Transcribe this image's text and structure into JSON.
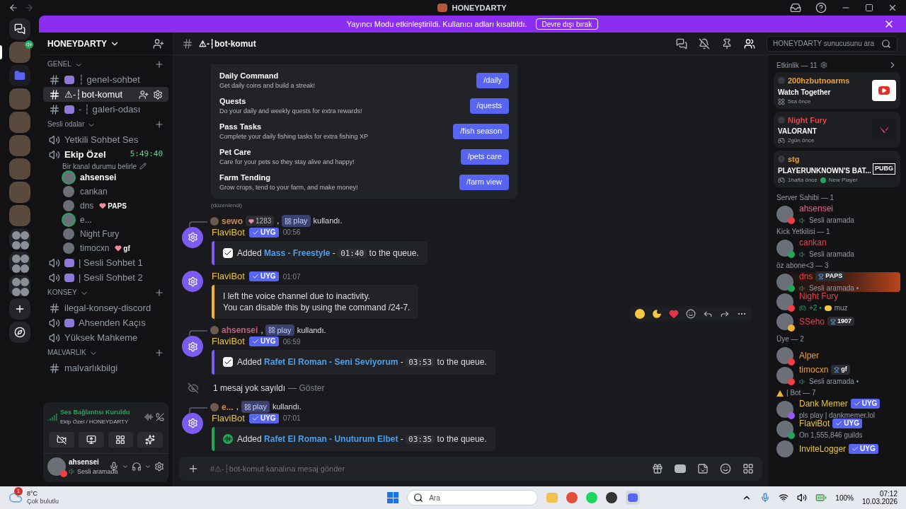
{
  "titlebar": {
    "title": "HONEYDARTY"
  },
  "banner": {
    "text": "Yayıncı Modu etkinleştirildi. Kullanıcı adları kısaltıldı.",
    "button": "Devre dışı bırak"
  },
  "servers": [
    {
      "kind": "home",
      "selected": false,
      "in_voice": false
    },
    {
      "kind": "server",
      "selected": true,
      "in_voice": true
    },
    {
      "kind": "folder",
      "selected": false,
      "in_voice": false
    },
    {
      "kind": "server",
      "selected": false,
      "in_voice": false
    },
    {
      "kind": "server",
      "selected": false,
      "in_voice": false
    },
    {
      "kind": "server",
      "selected": false,
      "in_voice": false
    },
    {
      "kind": "server",
      "selected": false,
      "in_voice": false
    },
    {
      "kind": "server",
      "selected": false,
      "in_voice": false
    },
    {
      "kind": "server",
      "selected": false,
      "in_voice": false
    },
    {
      "kind": "group",
      "selected": false,
      "in_voice": false
    },
    {
      "kind": "group",
      "selected": false,
      "in_voice": false
    },
    {
      "kind": "group",
      "selected": false,
      "in_voice": false
    },
    {
      "kind": "add",
      "selected": false,
      "in_voice": false
    },
    {
      "kind": "discover",
      "selected": false,
      "in_voice": false
    }
  ],
  "sidebar": {
    "server_name": "HONEYDARTY",
    "categories": [
      {
        "name": "GENEL",
        "channels": [
          {
            "kind": "text",
            "name": "┆ genel-sohbet",
            "emoji": true,
            "selected": false
          },
          {
            "kind": "text",
            "name": "⚠-┆bot-komut",
            "emoji": false,
            "selected": true
          },
          {
            "kind": "text",
            "name": "- ┆ galeri-odası",
            "emoji": true,
            "selected": false
          }
        ]
      },
      {
        "name": "Sesli odalar",
        "channels": [
          {
            "kind": "voice",
            "name": "Yetkili Sohbet Ses",
            "emoji": false,
            "selected": false
          },
          {
            "kind": "voice",
            "name": "Ekip Özel",
            "emoji": false,
            "selected": false,
            "timer": "5:49:40",
            "status": "Bir kanal durumu belirle",
            "users": [
              {
                "name": "ahsensei",
                "speaking": true,
                "self": true
              },
              {
                "name": "cankan",
                "speaking": false,
                "self": false
              },
              {
                "name": "dns",
                "speaking": false,
                "self": false,
                "badge": "PAPS"
              },
              {
                "name": "e...",
                "speaking": true,
                "self": false
              },
              {
                "name": "Night Fury",
                "speaking": false,
                "self": false
              },
              {
                "name": "timocxn",
                "speaking": false,
                "self": false,
                "badge": "gf"
              }
            ]
          },
          {
            "kind": "voice",
            "name": "| Sesli Sohbet 1",
            "emoji": true,
            "selected": false
          },
          {
            "kind": "voice",
            "name": "| Sesli Sohbet 2",
            "emoji": true,
            "selected": false
          }
        ]
      },
      {
        "name": "KONSEY",
        "channels": [
          {
            "kind": "text",
            "name": "ilegal-konsey-discord",
            "emoji": false,
            "selected": false
          },
          {
            "kind": "voice",
            "name": "Ahsenden Kaçıs",
            "emoji": true,
            "selected": false
          },
          {
            "kind": "voice",
            "name": "Yüksek Mahkeme",
            "emoji": false,
            "selected": false
          }
        ]
      },
      {
        "name": "MALVARLIK",
        "channels": [
          {
            "kind": "text",
            "name": "malvarlıkbilgi",
            "emoji": false,
            "selected": false
          }
        ]
      }
    ]
  },
  "voice_panel": {
    "status": "Ses Bağlantısı Kuruldu",
    "location": "Ekip Özel / HONEYDARTY"
  },
  "user_panel": {
    "name": "ahsensei",
    "status": "Sesli aramada",
    "presence": {
      "color": "#f23f43"
    }
  },
  "header": {
    "channel": "⚠-┆bot-komut",
    "search_placeholder": "HONEYDARTY sunucusunu ara"
  },
  "embed": {
    "rows": [
      {
        "title": "Daily Command",
        "desc": "Get daily coins and build a streak!",
        "button": "/daily"
      },
      {
        "title": "Quests",
        "desc": "Do your daily and weekly quests for extra rewards!",
        "button": "/quests"
      },
      {
        "title": "Pass Tasks",
        "desc": "Complete your daily fishing tasks for extra fishing XP",
        "button": "/fish season"
      },
      {
        "title": "Pet Care",
        "desc": "Care for your pets so they stay alive and happy!",
        "button": "/pets care"
      },
      {
        "title": "Farm Tending",
        "desc": "Grow crops, tend to your farm, and make money!",
        "button": "/farm view"
      }
    ],
    "edited": "(düzenlendi)"
  },
  "messages": [
    {
      "kind": "message",
      "reply": {
        "user": "sewo",
        "color": "#c98a4b",
        "badge": "1283",
        "sep": ",",
        "command": "play",
        "verb": "kullandı."
      },
      "author": "FlaviBot",
      "tag": "UYG",
      "time": "00:56",
      "embed": {
        "kind": "queued",
        "color": "#7c5cf0",
        "prefix": "Added",
        "song": "Mass -  Freestyle",
        "sep": "-",
        "duration": "01:40",
        "suffix": "to the queue."
      }
    },
    {
      "kind": "message",
      "author": "FlaviBot",
      "tag": "UYG",
      "time": "01:07",
      "embed": {
        "kind": "notice",
        "color": "#f0b232",
        "lines": [
          "I left the voice channel due to inactivity.",
          "You can disable this by using the command /24-7."
        ]
      }
    },
    {
      "kind": "message",
      "reply": {
        "user": "ahsensei",
        "color": "#c0607a",
        "sep": ",",
        "command": "play",
        "verb": "kullandı."
      },
      "author": "FlaviBot",
      "tag": "UYG",
      "time": "06:59",
      "embed": {
        "kind": "queued",
        "color": "#7c5cf0",
        "prefix": "Added",
        "song": "Rafet El Roman - Seni Seviyorum",
        "sep": "-",
        "duration": "03:53",
        "suffix": "to the queue."
      }
    },
    {
      "kind": "ignored",
      "text": "1 mesaj yok sayıldı",
      "action": "— Göster"
    },
    {
      "kind": "message",
      "reply": {
        "user": "e...",
        "color": "#c98a4b",
        "sep": ",",
        "command": "play",
        "verb": "kullandı."
      },
      "author": "FlaviBot",
      "tag": "UYG",
      "time": "07:01",
      "embed": {
        "kind": "streamed",
        "color": "#23a55a",
        "prefix": "Added",
        "song": "Rafet El Roman - Unuturum Elbet",
        "sep": "-",
        "duration": "03:35",
        "suffix": "to the queue."
      }
    }
  ],
  "composer": {
    "placeholder": "#⚠-┆bot-komut kanalına mesaj gönder"
  },
  "members": {
    "activity_title": "Etkinlik — 11",
    "activities": [
      {
        "kind": "app",
        "user": "200hzbutnoarms",
        "color": "#e8a23a",
        "title": "Watch Together",
        "meta": "5sa önce"
      },
      {
        "kind": "game",
        "user": "Night Fury",
        "color": "#e0474c",
        "title": "VALORANT",
        "meta": "2gün önce"
      },
      {
        "kind": "game",
        "user": "stg",
        "color": "#e8a23a",
        "title": "PLAYERUNKNOWN'S BAT...",
        "meta": "1hafta önce",
        "extra": "New Player",
        "thumb_text": "PUBG"
      }
    ],
    "groups": [
      {
        "title": "Server Sahibi — 1",
        "warn": false,
        "members": [
          {
            "kind": "voice",
            "name": "ahsensei",
            "color": "#e06c8c",
            "presence": {
              "color": "#f23f43"
            },
            "highlight": false,
            "status": "Sesli aramada"
          }
        ]
      },
      {
        "title": "Kick Yetkilisi — 1",
        "warn": false,
        "members": [
          {
            "kind": "voice",
            "name": "cankan",
            "color": "#e0474c",
            "presence": {
              "color": "#23a55a"
            },
            "highlight": false,
            "status": "Sesli aramada"
          }
        ]
      },
      {
        "title": "öz abone<3 — 3",
        "warn": false,
        "members": [
          {
            "kind": "voice",
            "name": "dns",
            "color": "#e0474c",
            "presence": {
              "color": "#23a55a"
            },
            "highlight": true,
            "badge": "PAPS",
            "status": "Sesli aramada •"
          },
          {
            "kind": "game",
            "name": "Night Fury",
            "color": "#e0474c",
            "presence": {
              "color": "#f23f43"
            },
            "highlight": false,
            "status_lead": "+2 •",
            "status": "muz"
          },
          {
            "kind": "plain",
            "name": "SSeho",
            "color": "#e0474c",
            "presence": {
              "color": "#f0b232"
            },
            "highlight": false,
            "badge": "1907"
          }
        ]
      },
      {
        "title": "Üye — 2",
        "warn": false,
        "members": [
          {
            "kind": "plain",
            "name": "Alper",
            "color": "#e8a23a",
            "presence": {
              "color": "#f23f43"
            },
            "highlight": false
          },
          {
            "kind": "voice",
            "name": "timocxn",
            "color": "#e8a23a",
            "presence": {
              "color": "#f23f43"
            },
            "highlight": false,
            "badge": "gf",
            "status": "Sesli aramada •"
          }
        ]
      },
      {
        "title": "| Bot — 7",
        "warn": true,
        "members": [
          {
            "kind": "text",
            "name": "Dank Memer",
            "color": "#e8c63a",
            "presence": {
              "color": "#9b59f5"
            },
            "highlight": false,
            "tag": "UYG",
            "status": "pls play | dankmemer.lol"
          },
          {
            "kind": "text",
            "name": "FlaviBot",
            "color": "#e8c63a",
            "presence": {
              "color": "#23a55a"
            },
            "highlight": false,
            "tag": "UYG",
            "status": "On 1,555,846 guilds"
          },
          {
            "kind": "plain",
            "name": "InviteLogger",
            "color": "#e8c63a",
            "highlight": false,
            "tag": "UYG"
          }
        ]
      }
    ]
  },
  "taskbar": {
    "temp": "8°C",
    "weather": "Çok bulutlu",
    "notifications": "1",
    "search": "Ara",
    "battery": "100%",
    "time": "07:12",
    "date": "10.03.2026"
  }
}
